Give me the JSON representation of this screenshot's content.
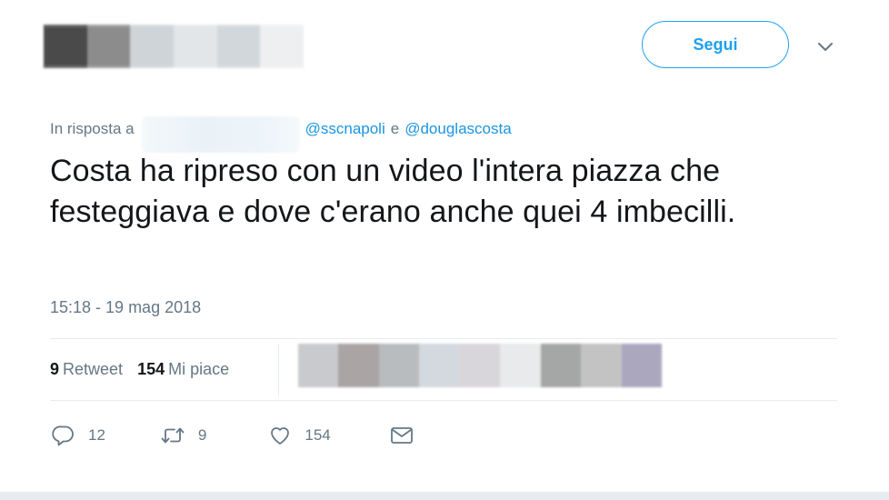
{
  "author": {
    "blur_colors": [
      "#4a4a4a",
      "#8c8c8c",
      "#cfd4d8",
      "#e3e6e8",
      "#d2d7db",
      "#eeeff0"
    ]
  },
  "header": {
    "follow_label": "Segui"
  },
  "reply": {
    "prefix": "In risposta a",
    "mentions": [
      "@sscnapoli",
      "@douglascosta"
    ],
    "separator": "e"
  },
  "tweet": {
    "text": "Costa ha ripreso con un video l'intera piazza che festeggiava e dove c'erano anche quei 4 imbecilli.",
    "timestamp": "15:18 - 19 mag 2018"
  },
  "stats": {
    "retweets_count": "9",
    "retweets_label": "Retweet",
    "likes_count": "154",
    "likes_label": "Mi piace",
    "avatar_blur_colors": [
      "#c9cacd",
      "#aaa4a5",
      "#b9bcbf",
      "#d3d9de",
      "#d9d6db",
      "#e8eaeb",
      "#a4a7a5",
      "#c4c3c4",
      "#aaa7bf"
    ]
  },
  "actions": {
    "reply_count": "12",
    "retweet_count": "9",
    "like_count": "154"
  },
  "colors": {
    "accent": "#1da1f2",
    "link": "#1b95e0",
    "muted": "#657786",
    "text": "#14171a",
    "divider": "#e6ecf0"
  }
}
